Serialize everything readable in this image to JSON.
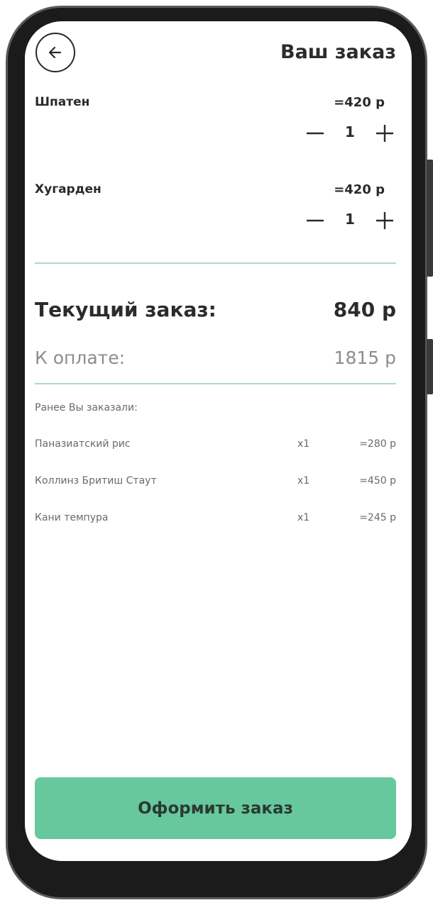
{
  "header": {
    "title": "Ваш заказ"
  },
  "cart": {
    "items": [
      {
        "name": "Шпатен",
        "price": "=420 р",
        "qty": "1"
      },
      {
        "name": "Хугарден",
        "price": "=420 р",
        "qty": "1"
      }
    ]
  },
  "summary": {
    "current_label": "Текущий заказ:",
    "current_value": "840 р",
    "pay_label": "К оплате:",
    "pay_value": "1815 р"
  },
  "previous": {
    "heading": "Ранее Вы заказали:",
    "items": [
      {
        "name": "Паназиатский рис",
        "qty": "x1",
        "price": "=280 р"
      },
      {
        "name": "Коллинз Бритиш Стаут",
        "qty": "x1",
        "price": "=450 р"
      },
      {
        "name": "Кани темпура",
        "qty": "x1",
        "price": "=245 р"
      }
    ]
  },
  "actions": {
    "order_label": "Оформить заказ"
  },
  "colors": {
    "accent": "#66c89c",
    "divider": "#a8dcc4"
  },
  "icons": {
    "back": "arrow-left-icon",
    "minus": "minus-icon",
    "plus": "plus-icon"
  }
}
